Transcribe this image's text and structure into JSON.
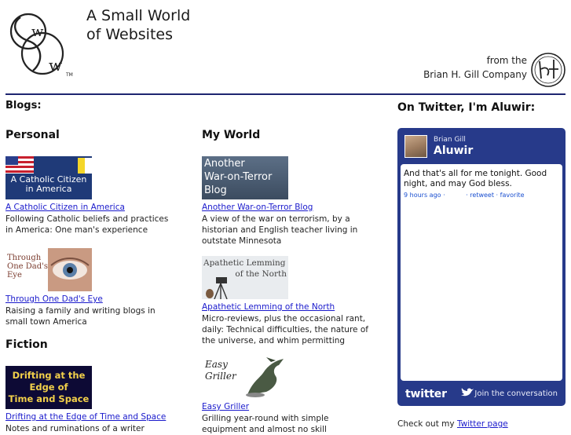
{
  "header": {
    "title_line1": "A Small World",
    "title_line2": "of Websites",
    "from_line1": "from the",
    "from_line2": "Brian H. Gill Company",
    "logo_tm": "TM"
  },
  "blogs_heading": "Blogs:",
  "personal": {
    "heading": "Personal",
    "items": [
      {
        "link": "A Catholic Citizen in America",
        "desc": "Following Catholic beliefs and practices in America: One man's experience",
        "thumb_text": "A Catholic Citizen in America"
      },
      {
        "link": "Through One Dad's Eye",
        "desc": "Raising a family and writing blogs in small town America",
        "thumb_text_1": "Through",
        "thumb_text_2": "One Dad's",
        "thumb_text_3": "Eye"
      }
    ]
  },
  "myworld": {
    "heading": "My World",
    "items": [
      {
        "link": "Another War-on-Terror Blog",
        "desc": "A view of the war on terrorism, by a historian and English teacher living in outstate Minnesota",
        "thumb_text_1": "Another",
        "thumb_text_2": "War-on-Terror",
        "thumb_text_3": "Blog"
      },
      {
        "link": "Apathetic Lemming of the North",
        "desc": "Micro-reviews, plus the occasional rant, daily: Technical difficulties, the nature of the universe, and whim permitting",
        "thumb_text_1": "Apathetic Lemming",
        "thumb_text_2": "of the North"
      },
      {
        "link": "Easy Griller",
        "desc": "Grilling year-round with simple equipment and almost no skill",
        "thumb_text_1": "Easy",
        "thumb_text_2": "Griller"
      }
    ]
  },
  "fiction": {
    "heading": "Fiction",
    "items": [
      {
        "link": "Drifting at the Edge of Time and Space",
        "desc": "Notes and ruminations of a writer",
        "thumb_text_1": "Drifting at the",
        "thumb_text_2": "Edge of",
        "thumb_text_3": "Time and Space"
      }
    ]
  },
  "twitter": {
    "heading": "On Twitter, I'm Aluwir:",
    "name": "Brian Gill",
    "handle": "Aluwir",
    "tweet": "And that's all for me tonight. Good night, and may God bless.",
    "time": "9 hours ago",
    "dot": "·",
    "retweet": "retweet",
    "favorite": "favorite",
    "footer_logo": "twitter",
    "join": "Join the conversation",
    "check_prefix": "Check out my ",
    "check_link": "Twitter page"
  },
  "colors": {
    "rule": "#1d2570",
    "widget": "#273a8a",
    "link": "#1a1acc"
  }
}
